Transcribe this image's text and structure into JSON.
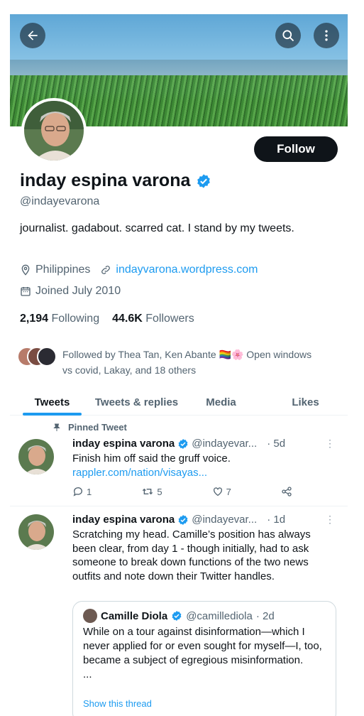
{
  "profile": {
    "name": "inday espina varona",
    "handle": "@indayevarona",
    "bio": "journalist. gadabout. scarred cat. I stand by my tweets.",
    "location": "Philippines",
    "website": "indayvarona.wordpress.com",
    "joined": "Joined July 2010",
    "following_count": "2,194",
    "following_label": "Following",
    "followers_count": "44.6K",
    "followers_label": "Followers",
    "follow_button": "Follow",
    "followed_by": "Followed by Thea Tan, Ken Abante 🏳️‍🌈🌸 Open windows vs covid, Lakay, and 18 others"
  },
  "tabs": [
    "Tweets",
    "Tweets & replies",
    "Media",
    "Likes"
  ],
  "tweets": [
    {
      "pinned_label": "Pinned Tweet",
      "name": "inday espina varona",
      "handle": "@indayevar...",
      "time": "· 5d",
      "text": "Finish him off said the gruff voice.",
      "link": "rappler.com/nation/visayas...",
      "replies": "1",
      "retweets": "5",
      "likes": "7"
    },
    {
      "name": "inday espina varona",
      "handle": "@indayevar...",
      "time": "· 1d",
      "text": "Scratching my head. Camille’s position has always been clear, from day 1 - though initially, had to ask someone to break down functions of the two news outfits and note down their Twitter handles.",
      "quote": {
        "name": "Camille Diola",
        "handle": "@camillediola",
        "time": "· 2d",
        "text": "While on a tour against disinformation—which I never applied for or even sought for myself—I, too, became a subject of egregious misinformation.",
        "ellipsis": "...",
        "show_thread": "Show this thread"
      }
    }
  ],
  "colors": {
    "accent": "#1d9bf0",
    "text": "#0f1419",
    "muted": "#536471",
    "verified": "#1d9bf0"
  },
  "icons": [
    "back-arrow-icon",
    "search-icon",
    "more-vertical-icon",
    "verified-badge-icon",
    "location-pin-icon",
    "link-icon",
    "calendar-icon",
    "pin-icon",
    "reply-icon",
    "retweet-icon",
    "like-icon",
    "share-icon"
  ]
}
